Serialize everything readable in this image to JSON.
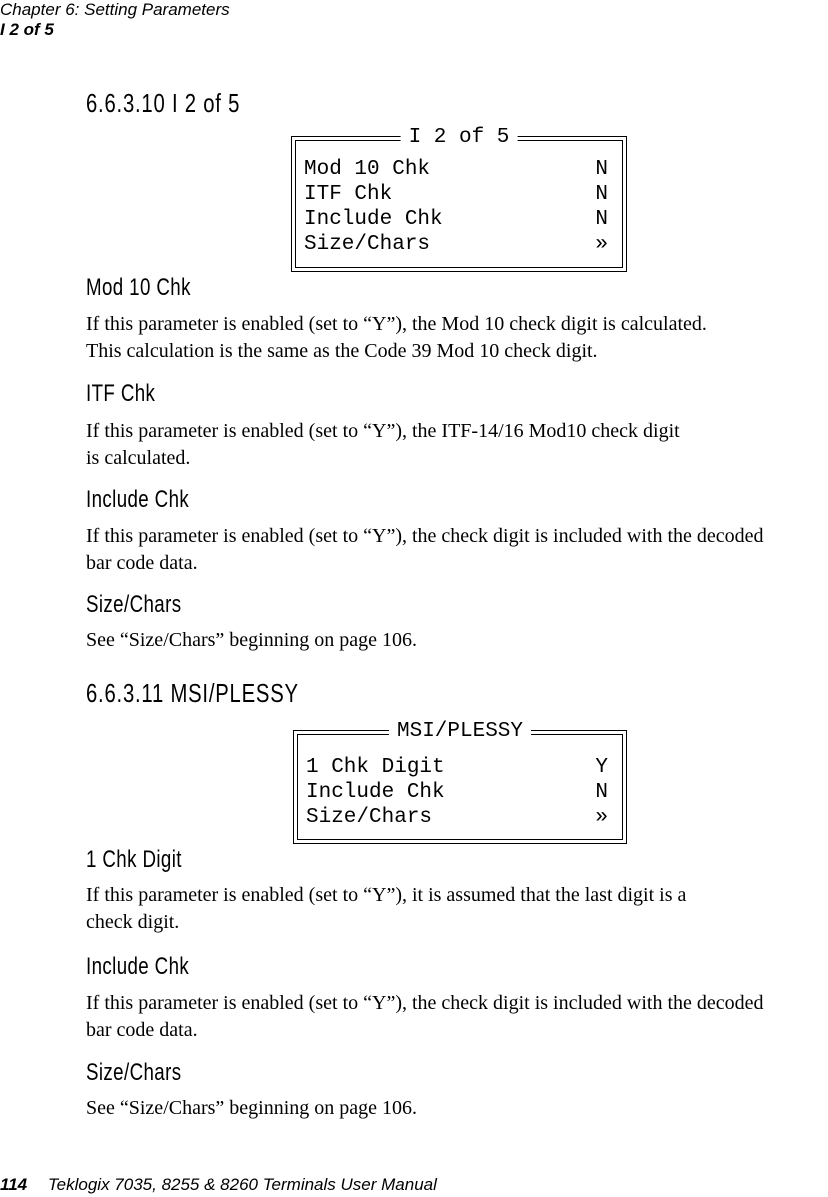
{
  "header": {
    "chapter": "Chapter  6:  Setting Parameters",
    "section": "I 2 of 5"
  },
  "sections": [
    {
      "title": "6.6.3.10  I 2 of 5",
      "lcd": {
        "title": "I 2 of 5",
        "rows": [
          {
            "label": "Mod 10 Chk",
            "value": "N"
          },
          {
            "label": "ITF Chk",
            "value": "N"
          },
          {
            "label": "Include Chk",
            "value": "N"
          },
          {
            "label": "Size/Chars",
            "value": "»"
          }
        ]
      },
      "params": [
        {
          "name": "Mod 10 Chk",
          "text": "If this parameter is enabled (set to “Y”), the Mod 10 check digit is calculated.\nThis calculation is the same as the Code 39 Mod 10 check digit."
        },
        {
          "name": "ITF Chk",
          "text": "If this parameter is enabled (set to “Y”), the ITF-14/16 Mod10 check digit\nis calculated."
        },
        {
          "name": "Include Chk",
          "text": "If this parameter is enabled (set to “Y”), the check digit is included with the decoded\nbar code data."
        },
        {
          "name": "Size/Chars",
          "text": "See “Size/Chars” beginning on page 106."
        }
      ]
    },
    {
      "title": "6.6.3.11  MSI/PLESSY",
      "lcd": {
        "title": "MSI/PLESSY",
        "rows": [
          {
            "label": "1 Chk Digit",
            "value": "Y"
          },
          {
            "label": "Include Chk",
            "value": "N"
          },
          {
            "label": "Size/Chars",
            "value": "»"
          }
        ]
      },
      "params": [
        {
          "name": "1 Chk Digit",
          "text": "If this parameter is enabled (set to “Y”), it is assumed that the last digit is a\ncheck digit."
        },
        {
          "name": "Include Chk",
          "text": "If this parameter is enabled (set to “Y”), the check digit is included with the decoded\nbar code data."
        },
        {
          "name": "Size/Chars",
          "text": "See “Size/Chars” beginning on page 106."
        }
      ]
    }
  ],
  "footer": {
    "page_number": "114",
    "manual_title": "Teklogix 7035, 8255 & 8260 Terminals User Manual"
  }
}
